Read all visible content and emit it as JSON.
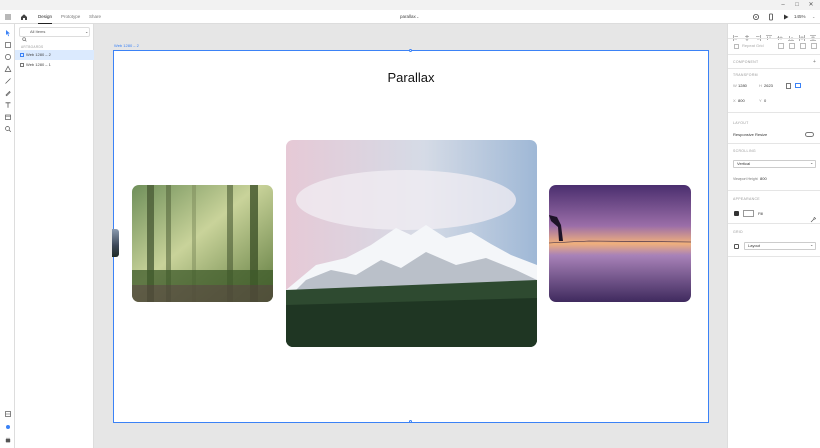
{
  "window": {
    "min": "–",
    "max": "□",
    "close": "✕"
  },
  "topbar": {
    "tabs": [
      "Design",
      "Prototype",
      "Share"
    ],
    "doc_title": "parallax",
    "zoom": "145%"
  },
  "layers": {
    "filter_label": "All Items",
    "section_label": "ARTBOARDS",
    "items": [
      {
        "label": "Web 1280 – 2"
      },
      {
        "label": "Web 1280 – 1"
      }
    ]
  },
  "canvas": {
    "artboard_label": "Web 1280 – 2",
    "heading": "Parallax"
  },
  "props": {
    "repeat_grid": "Repeat Grid",
    "component": "COMPONENT",
    "transform": "TRANSFORM",
    "w_label": "W",
    "w": "1280",
    "h_label": "H",
    "h": "2623",
    "x_label": "X",
    "x": "800",
    "y_label": "Y",
    "y": "0",
    "layout": "LAYOUT",
    "responsive_resize": "Responsive Resize",
    "scrolling": "SCROLLING",
    "scroll_mode": "Vertical",
    "viewport_label": "Viewport Height",
    "viewport_value": "800",
    "appearance": "APPEARANCE",
    "fill_label": "Fill",
    "grid": "GRID",
    "grid_mode": "Layout"
  },
  "colors": {
    "accent": "#3b82f6",
    "selection": "#dbeafe"
  }
}
